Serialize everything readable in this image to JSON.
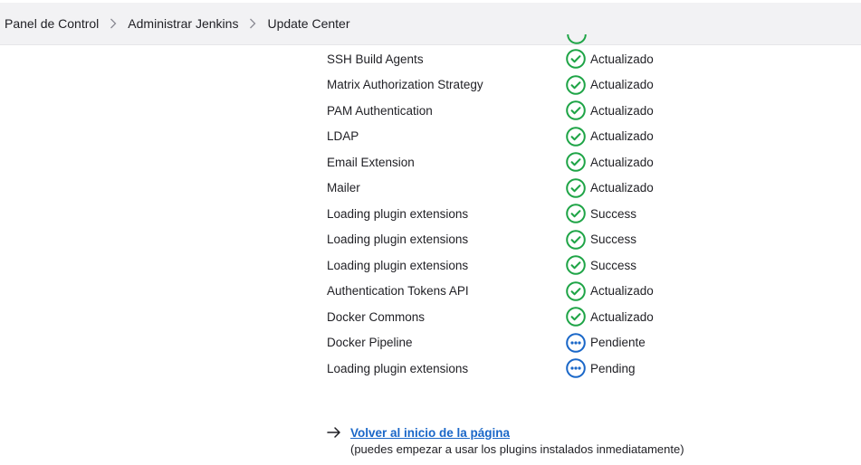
{
  "breadcrumb": {
    "items": [
      {
        "label": "Panel de Control"
      },
      {
        "label": "Administrar Jenkins"
      },
      {
        "label": "Update Center"
      }
    ]
  },
  "plugins": [
    {
      "name": "SSH Build Agents",
      "status": "Actualizado",
      "state": "success"
    },
    {
      "name": "Matrix Authorization Strategy",
      "status": "Actualizado",
      "state": "success"
    },
    {
      "name": "PAM Authentication",
      "status": "Actualizado",
      "state": "success"
    },
    {
      "name": "LDAP",
      "status": "Actualizado",
      "state": "success"
    },
    {
      "name": "Email Extension",
      "status": "Actualizado",
      "state": "success"
    },
    {
      "name": "Mailer",
      "status": "Actualizado",
      "state": "success"
    },
    {
      "name": "Loading plugin extensions",
      "status": "Success",
      "state": "success"
    },
    {
      "name": "Loading plugin extensions",
      "status": "Success",
      "state": "success"
    },
    {
      "name": "Loading plugin extensions",
      "status": "Success",
      "state": "success"
    },
    {
      "name": "Authentication Tokens API",
      "status": "Actualizado",
      "state": "success"
    },
    {
      "name": "Docker Commons",
      "status": "Actualizado",
      "state": "success"
    },
    {
      "name": "Docker Pipeline",
      "status": "Pendiente",
      "state": "pending"
    },
    {
      "name": "Loading plugin extensions",
      "status": "Pending",
      "state": "pending"
    }
  ],
  "footer": {
    "back_link": "Volver al inicio de la página",
    "note": "(puedes empezar a usar los plugins instalados inmediatamente)"
  },
  "colors": {
    "success": "#1ea446",
    "pending": "#1a67c8",
    "link": "#1a67c8"
  },
  "icons": {
    "success": "check-circle-icon",
    "pending": "ellipsis-circle-icon",
    "separator": "chevron-right-icon",
    "back": "arrow-right-icon"
  }
}
